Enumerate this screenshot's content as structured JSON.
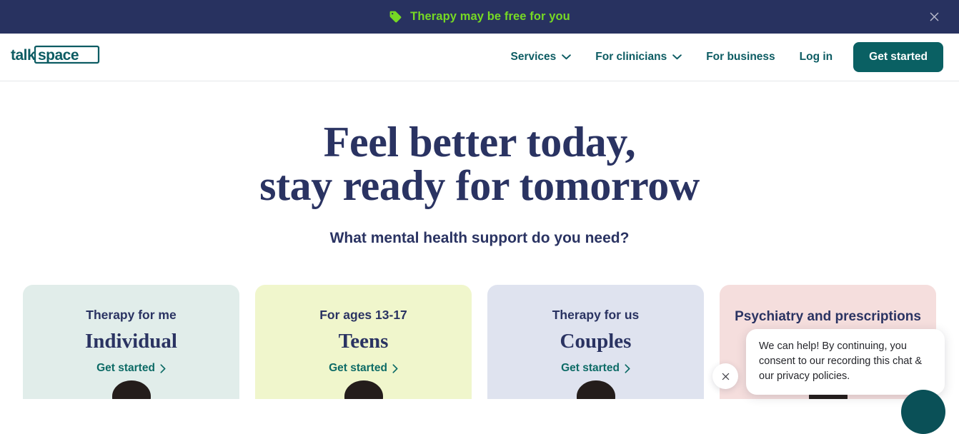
{
  "promo_banner": {
    "icon": "price-tag-icon",
    "text": "Therapy may be free for you",
    "close_icon": "close-icon",
    "background_color": "#283260",
    "text_color": "#76d924"
  },
  "header": {
    "logo_text": "talkspace",
    "logo_part_1": "talk",
    "logo_part_2": "space",
    "brand_color": "#0d5c63",
    "nav": [
      {
        "label": "Services",
        "has_dropdown": true,
        "icon": "chevron-down-icon"
      },
      {
        "label": "For clinicians",
        "has_dropdown": true,
        "icon": "chevron-down-icon"
      },
      {
        "label": "For business",
        "has_dropdown": false
      },
      {
        "label": "Log in",
        "has_dropdown": false
      }
    ],
    "cta_label": "Get started",
    "cta_color": "#0a6063"
  },
  "hero": {
    "title_line_1": "Feel better today,",
    "title_line_2": "stay ready for tomorrow",
    "subtitle": "What mental health support do you need?",
    "title_color": "#2a3362"
  },
  "cards": [
    {
      "eyebrow": "Therapy for me",
      "title": "Individual",
      "cta": "Get started",
      "cta_icon": "chevron-right-icon",
      "background_color": "#e1edea"
    },
    {
      "eyebrow": "For ages 13-17",
      "title": "Teens",
      "cta": "Get started",
      "cta_icon": "chevron-right-icon",
      "background_color": "#f0f6cc"
    },
    {
      "eyebrow": "Therapy for us",
      "title": "Couples",
      "cta": "Get started",
      "cta_icon": "chevron-right-icon",
      "background_color": "#dfe3ef"
    },
    {
      "eyebrow": "Psychiatry and prescriptions",
      "title": "",
      "cta": "",
      "cta_icon": "",
      "background_color": "#f5dedd"
    }
  ],
  "chat_widget": {
    "message": "We can help! By continuing, you consent to our recording this chat & our privacy policies.",
    "close_icon": "close-icon",
    "launcher_icon": "chat-icon",
    "launcher_color": "#0a5057"
  }
}
